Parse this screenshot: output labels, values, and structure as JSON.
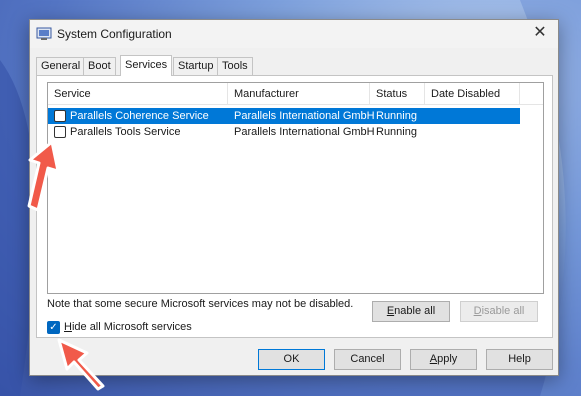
{
  "window": {
    "title": "System Configuration",
    "close_glyph": "✕",
    "icon": "msconfig-icon"
  },
  "tabs": [
    {
      "label": "General"
    },
    {
      "label": "Boot"
    },
    {
      "label": "Services",
      "active": true
    },
    {
      "label": "Startup"
    },
    {
      "label": "Tools"
    }
  ],
  "services": {
    "columns": [
      "Service",
      "Manufacturer",
      "Status",
      "Date Disabled"
    ],
    "rows": [
      {
        "checked": false,
        "service": "Parallels Coherence Service",
        "manufacturer": "Parallels International GmbH",
        "status": "Running",
        "date_disabled": "",
        "selected": true
      },
      {
        "checked": false,
        "service": "Parallels Tools Service",
        "manufacturer": "Parallels International GmbH",
        "status": "Running",
        "date_disabled": "",
        "selected": false
      }
    ]
  },
  "note": "Note that some secure Microsoft services may not be disabled.",
  "enable_all": {
    "mnemonic": "E",
    "rest": "nable all"
  },
  "disable_all": {
    "mnemonic": "D",
    "rest": "isable all"
  },
  "hide_ms": {
    "checked": true,
    "mnemonic": "H",
    "rest": "ide all Microsoft services"
  },
  "footer": {
    "ok": "OK",
    "cancel": "Cancel",
    "apply": {
      "mnemonic": "A",
      "rest": "pply"
    },
    "help": "Help"
  },
  "colors": {
    "accent": "#0078d7",
    "arrow": "#f15a4a"
  }
}
